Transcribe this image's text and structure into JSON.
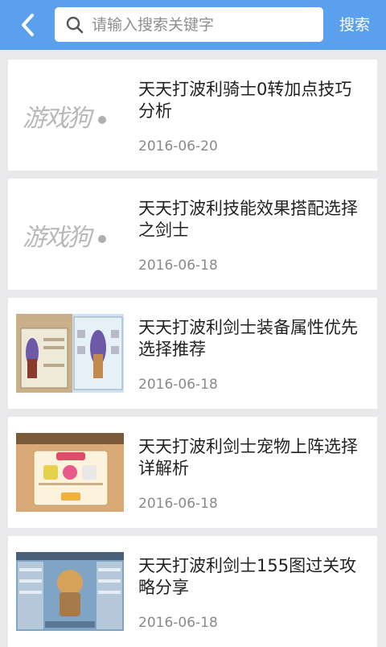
{
  "header": {
    "back_icon": "chevron-left-icon",
    "search_icon": "search-icon",
    "search_placeholder": "请输入搜索关键字",
    "search_button": "搜索"
  },
  "colors": {
    "header_bg": "#5aa0ec",
    "page_bg": "#e9e9ec",
    "card_bg": "#ffffff",
    "title_text": "#222222",
    "date_text": "#8a8a8a"
  },
  "articles": [
    {
      "title": "天天打波利骑士0转加点技巧分析",
      "date": "2016-06-20",
      "thumb": "logo",
      "logo_text": "游戏狗"
    },
    {
      "title": "天天打波利技能效果搭配选择之剑士",
      "date": "2016-06-18",
      "thumb": "logo",
      "logo_text": "游戏狗"
    },
    {
      "title": "天天打波利剑士装备属性优先选择推荐",
      "date": "2016-06-18",
      "thumb": "screenshot-equipment"
    },
    {
      "title": "天天打波利剑士宠物上阵选择详解析",
      "date": "2016-06-18",
      "thumb": "screenshot-pet"
    },
    {
      "title": "天天打波利剑士155图过关攻略分享",
      "date": "2016-06-18",
      "thumb": "screenshot-character"
    }
  ]
}
